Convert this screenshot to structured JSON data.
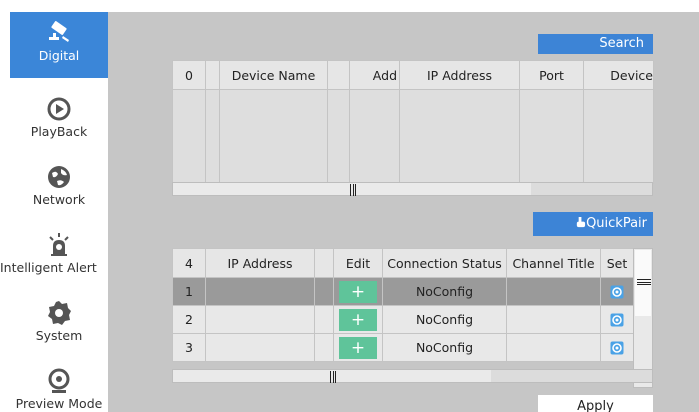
{
  "sidebar": {
    "items": [
      {
        "label": "Digital",
        "icon": "camera-icon",
        "active": true
      },
      {
        "label": "PlayBack",
        "icon": "playback-icon",
        "active": false
      },
      {
        "label": "Network",
        "icon": "network-globe-icon",
        "active": false
      },
      {
        "label": "Intelligent Alert",
        "icon": "alarm-light-icon",
        "active": false
      },
      {
        "label": "System",
        "icon": "gear-icon",
        "active": false
      },
      {
        "label": "Preview Mode",
        "icon": "webcam-icon",
        "active": false
      }
    ]
  },
  "search_button": "Search",
  "device_table": {
    "columns": [
      "0",
      "",
      "Device Name",
      "",
      "Add",
      "IP Address",
      "Port",
      "Device"
    ],
    "rows": []
  },
  "quickpair_button": "QuickPair",
  "channel_table": {
    "columns": [
      "4",
      "IP Address",
      "",
      "Edit",
      "Connection Status",
      "Channel Title",
      "Set"
    ],
    "rows": [
      {
        "num": "1",
        "ip": "",
        "status": "NoConfig",
        "title": "",
        "selected": true
      },
      {
        "num": "2",
        "ip": "",
        "status": "NoConfig",
        "title": "",
        "selected": false
      },
      {
        "num": "3",
        "ip": "",
        "status": "NoConfig",
        "title": "",
        "selected": false
      }
    ],
    "edit_glyph": "+"
  },
  "apply_button": "Apply",
  "colors": {
    "accent": "#3d84d6",
    "add": "#5fc49a",
    "content_bg": "#c6c6c6",
    "selected_row": "#9a9a9a"
  }
}
